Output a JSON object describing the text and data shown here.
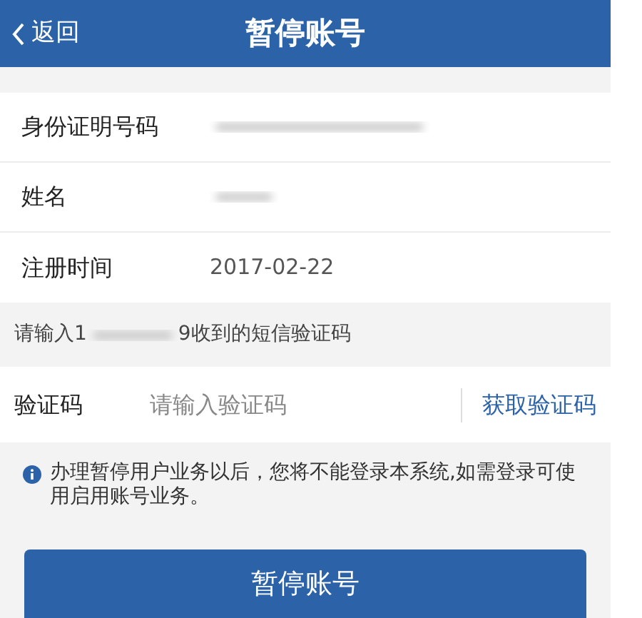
{
  "header": {
    "back_label": "返回",
    "title": "暂停账号"
  },
  "info_rows": [
    {
      "label": "身份证明号码",
      "kind": "mask"
    },
    {
      "label": "姓名",
      "kind": "shortmask"
    },
    {
      "label": "注册时间",
      "kind": "text",
      "value": "2017-02-22"
    }
  ],
  "sms_hint": {
    "prefix": "请输入1",
    "suffix": "9收到的短信验证码"
  },
  "code_field": {
    "label": "验证码",
    "placeholder": "请输入验证码",
    "action": "获取验证码"
  },
  "notice": "办理暂停用户业务以后，您将不能登录本系统,如需登录可使用启用账号业务。",
  "submit": "暂停账号"
}
